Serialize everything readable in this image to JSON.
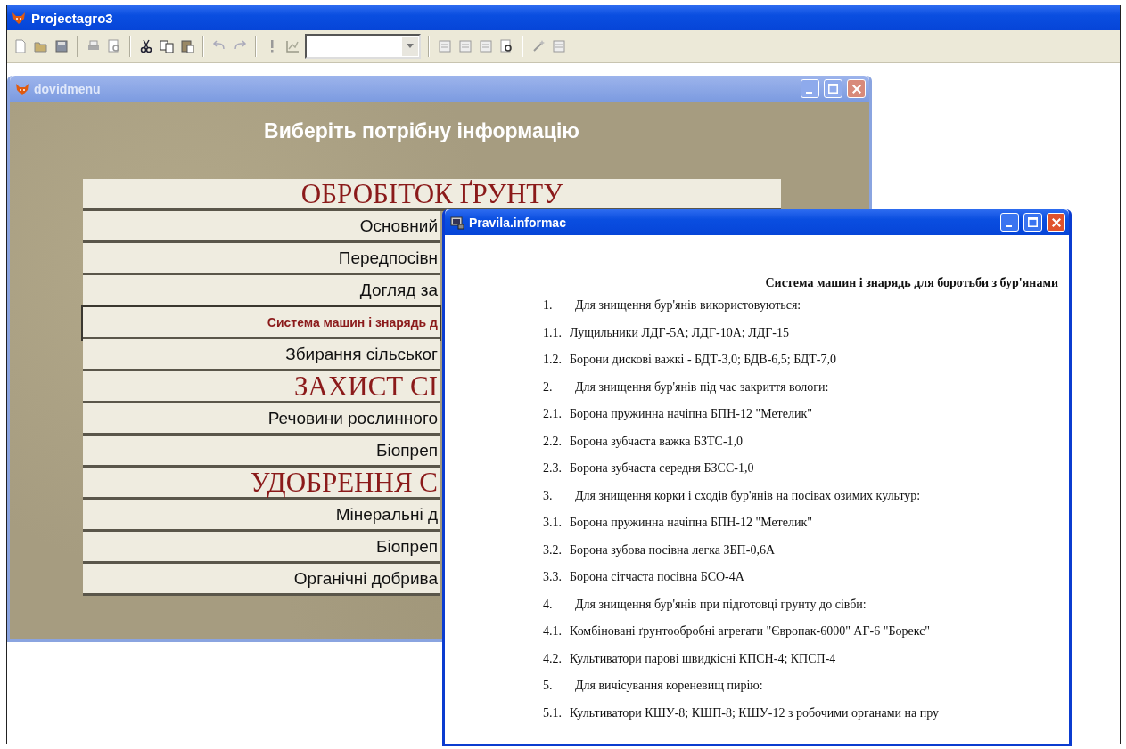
{
  "app": {
    "title": "Projectagro3"
  },
  "menu_window": {
    "title": "dovidmenu",
    "heading": "Виберіть потрібну інформацію",
    "items": [
      {
        "kind": "section",
        "label": "ОБРОБІТОК ҐРУНТУ",
        "selected": false
      },
      {
        "kind": "item",
        "label": "Основний",
        "selected": false
      },
      {
        "kind": "item",
        "label": "Передпосівн",
        "selected": false
      },
      {
        "kind": "item",
        "label": "Догляд за",
        "selected": false
      },
      {
        "kind": "item",
        "label": "Система машин і знарядь д",
        "selected": true
      },
      {
        "kind": "item",
        "label": "Збирання сільськог",
        "selected": false
      },
      {
        "kind": "section",
        "label": "ЗАХИСТ СІ",
        "selected": false
      },
      {
        "kind": "item",
        "label": "Речовини рослинного",
        "selected": false
      },
      {
        "kind": "item",
        "label": "Біопреп",
        "selected": false
      },
      {
        "kind": "section",
        "label": "УДОБРЕННЯ С",
        "selected": false
      },
      {
        "kind": "item",
        "label": "Мінеральні д",
        "selected": false
      },
      {
        "kind": "item",
        "label": "Біопреп",
        "selected": false
      },
      {
        "kind": "item",
        "label": "Органічні добрива",
        "selected": false
      }
    ]
  },
  "info_window": {
    "title": "Pravila.informac",
    "heading": "Система машин і знарядь для боротьби з бур'янами",
    "lines": [
      {
        "kind": "main",
        "number": "1.",
        "text": "Для знищення бур'янів використовуються:"
      },
      {
        "kind": "sub",
        "number": "1.1.",
        "text": "Лущильники ЛДГ-5А; ЛДГ-10А; ЛДГ-15"
      },
      {
        "kind": "sub",
        "number": "1.2.",
        "text": "Борони дискові важкі - БДТ-3,0; БДВ-6,5; БДТ-7,0"
      },
      {
        "kind": "main",
        "number": "2.",
        "text": "Для знищення бур'янів під час закриття вологи:"
      },
      {
        "kind": "sub",
        "number": "2.1.",
        "text": "Борона пружинна начіпна БПН-12 \"Метелик\""
      },
      {
        "kind": "sub",
        "number": "2.2.",
        "text": "Борона зубчаста важка БЗТС-1,0"
      },
      {
        "kind": "sub",
        "number": "2.3.",
        "text": "Борона зубчаста середня БЗСС-1,0"
      },
      {
        "kind": "main",
        "number": "3.",
        "text": "Для знищення корки і сходів бур'янів на посівах озимих культур:"
      },
      {
        "kind": "sub",
        "number": "3.1.",
        "text": "Борона пружинна начіпна БПН-12 \"Метелик\""
      },
      {
        "kind": "sub",
        "number": "3.2.",
        "text": "Борона зубова посівна легка ЗБП-0,6А"
      },
      {
        "kind": "sub",
        "number": "3.3.",
        "text": "Борона сітчаста посівна БСО-4А"
      },
      {
        "kind": "main",
        "number": "4.",
        "text": "Для знищення бур'янів при підготовці грунту до сівби:"
      },
      {
        "kind": "sub",
        "number": "4.1.",
        "text": "Комбіновані ґрунтообробні агрегати \"Європак-6000\" АГ-6 \"Борекс\""
      },
      {
        "kind": "sub",
        "number": "4.2.",
        "text": "Культиватори парові швидкісні КПСН-4; КПСП-4"
      },
      {
        "kind": "main",
        "number": "5.",
        "text": "Для вичісування кореневищ пирію:"
      },
      {
        "kind": "sub",
        "number": "5.1.",
        "text": "Культиватори КШУ-8; КШП-8; КШУ-12 з робочими органами на пру"
      }
    ]
  }
}
